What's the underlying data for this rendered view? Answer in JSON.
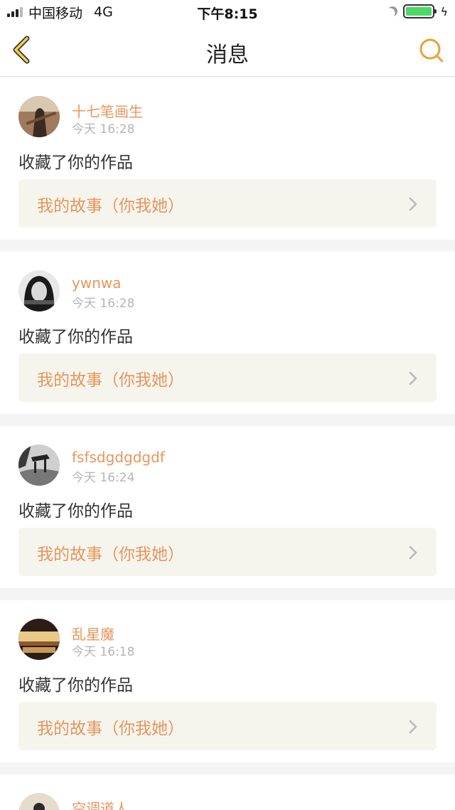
{
  "status_bar": {
    "carrier": "中国移动",
    "network": "4G",
    "time": "下午8:15"
  },
  "nav": {
    "title": "消息",
    "back_icon": "back-chevron-icon",
    "search_icon": "search-icon",
    "accent": "#e8a23a"
  },
  "messages": [
    {
      "user": "十七笔画生",
      "time": "今天 16:28",
      "action": "收藏了你的作品",
      "work": "我的故事（你我她）"
    },
    {
      "user": "ywnwa",
      "time": "今天 16:28",
      "action": "收藏了你的作品",
      "work": "我的故事（你我她）"
    },
    {
      "user": "fsfsdgdgdgdf",
      "time": "今天 16:24",
      "action": "收藏了你的作品",
      "work": "我的故事（你我她）"
    },
    {
      "user": "乱星魔",
      "time": "今天 16:18",
      "action": "收藏了你的作品",
      "work": "我的故事（你我她）"
    },
    {
      "user": "空调道人"
    }
  ]
}
